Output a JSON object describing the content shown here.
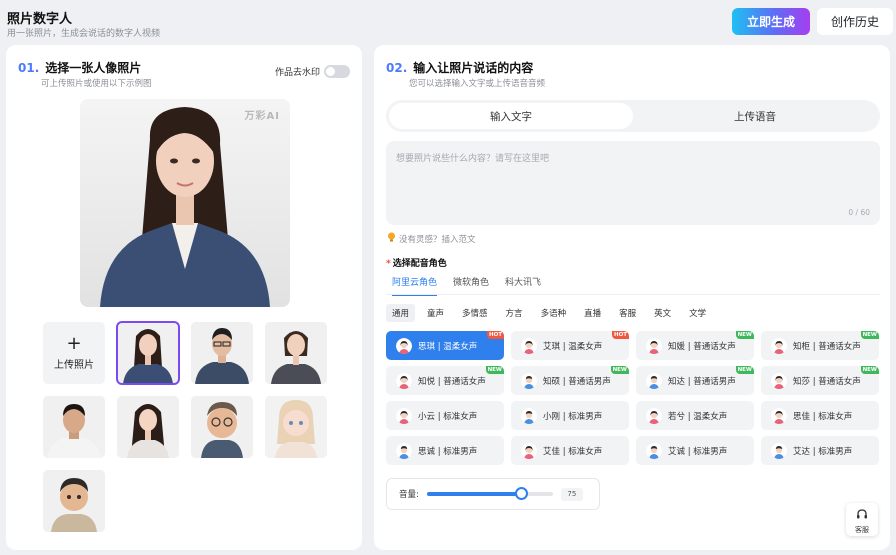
{
  "header": {
    "title": "照片数字人",
    "subtitle": "用一张照片，生成会说话的数字人视频",
    "generate_label": "立即生成",
    "history_label": "创作历史"
  },
  "left": {
    "num": "01.",
    "title": "选择一张人像照片",
    "subtitle": "可上传照片或使用以下示例图",
    "watermark_label": "作品去水印",
    "watermark_on": false,
    "preview_watermark": "万彩AI",
    "upload_label": "上传照片",
    "upload_plus": "+"
  },
  "right": {
    "num": "02.",
    "title": "输入让照片说话的内容",
    "subtitle": "您可以选择输入文字或上传语音音频",
    "tabs": [
      "输入文字",
      "上传语音"
    ],
    "active_tab": 0,
    "text_placeholder": "想要照片说些什么内容？请写在这里吧",
    "text_value": "",
    "char_count": "0 / 60",
    "hint": "没有灵感？插入范文",
    "voice_required_mark": "*",
    "voice_label": "选择配音角色",
    "vendors": [
      "阿里云角色",
      "微软角色",
      "科大讯飞"
    ],
    "categories": [
      "通用",
      "童声",
      "多情感",
      "方言",
      "多语种",
      "直播",
      "客服",
      "英文",
      "文学"
    ],
    "voices": [
      {
        "label": "思琪 | 温柔女声",
        "gender": "f",
        "badge": "HOT"
      },
      {
        "label": "艾琪 | 温柔女声",
        "gender": "f",
        "badge": "HOT"
      },
      {
        "label": "知媛 | 普通话女声",
        "gender": "f",
        "badge": "NEW"
      },
      {
        "label": "知柜 | 普通话女声",
        "gender": "f",
        "badge": "NEW"
      },
      {
        "label": "知悦 | 普通话女声",
        "gender": "f",
        "badge": "NEW"
      },
      {
        "label": "知硕 | 普通话男声",
        "gender": "m",
        "badge": "NEW"
      },
      {
        "label": "知达 | 普通话男声",
        "gender": "m",
        "badge": "NEW"
      },
      {
        "label": "知莎 | 普通话女声",
        "gender": "f",
        "badge": "NEW"
      },
      {
        "label": "小云 | 标准女声",
        "gender": "f",
        "badge": ""
      },
      {
        "label": "小刚 | 标准男声",
        "gender": "m",
        "badge": ""
      },
      {
        "label": "若兮 | 温柔女声",
        "gender": "f",
        "badge": ""
      },
      {
        "label": "思佳 | 标准女声",
        "gender": "f",
        "badge": ""
      },
      {
        "label": "思诚 | 标准男声",
        "gender": "m",
        "badge": ""
      },
      {
        "label": "艾佳 | 标准女声",
        "gender": "f",
        "badge": ""
      },
      {
        "label": "艾诚 | 标准男声",
        "gender": "m",
        "badge": ""
      },
      {
        "label": "艾达 | 标准男声",
        "gender": "m",
        "badge": ""
      }
    ],
    "active_voice": 0,
    "volume_label": "音量:",
    "volume_value": "75",
    "volume_max": 100
  },
  "service_label": "客服",
  "colors": {
    "accent": "#2f80ed",
    "hot": "#f2573f",
    "new": "#3fb85c",
    "select_outline": "#7a4bf0"
  }
}
